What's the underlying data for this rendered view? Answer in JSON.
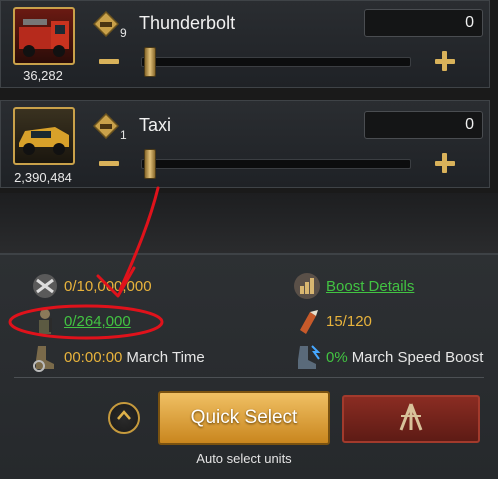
{
  "units": [
    {
      "name": "Thunderbolt",
      "count": "36,282",
      "tier": "9",
      "quantity": "0",
      "slider_fraction": 0
    },
    {
      "name": "Taxi",
      "count": "2,390,484",
      "tier": "1",
      "quantity": "0",
      "slider_fraction": 0
    }
  ],
  "stats": {
    "load": "0/10,000,000",
    "troops": "0/264,000",
    "march_time_value": "00:00:00",
    "march_time_label": "March Time",
    "boost_details": "Boost Details",
    "squads": "15/120",
    "march_speed_value": "0%",
    "march_speed_label": "March Speed Boost"
  },
  "actions": {
    "quick_select": "Quick Select",
    "auto_select": "Auto select units"
  },
  "colors": {
    "gold": "#e8b33c",
    "green": "#42c342",
    "annotation_red": "#e0121b"
  },
  "icons": [
    "truck-icon",
    "taxi-icon",
    "tier-badge-icon",
    "load-icon",
    "soldier-icon",
    "boots-icon",
    "boost-details-icon",
    "ammo-icon",
    "speed-boots-icon",
    "collapse-chevron-icon",
    "march-icon"
  ]
}
